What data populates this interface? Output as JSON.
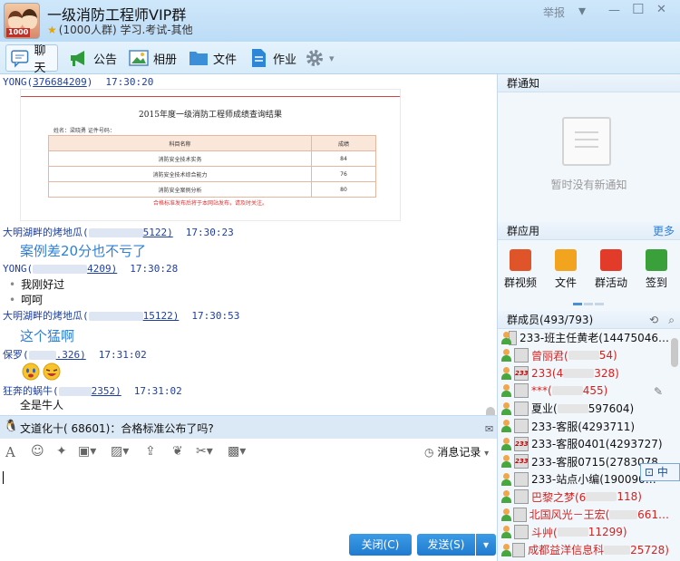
{
  "window": {
    "group_name": "一级消防工程师VIP群",
    "group_meta": "(1000人群) 学习.考试-其他",
    "avatar_badge": "1000",
    "report": "举报",
    "min": "—",
    "max": "☐",
    "close": "✕"
  },
  "toolbar": {
    "chat": "聊天",
    "announce": "公告",
    "album": "相册",
    "files": "文件",
    "homework": "作业"
  },
  "messages": {
    "m1": {
      "sender": "YONG",
      "qq": "376684209",
      "time": "17:30:20"
    },
    "scorecard": {
      "title": "2015年度一级消防工程师成绩查询结果",
      "info": "姓名：梁晓勇     证件号码：",
      "col_subject": "科目名称",
      "col_score": "成绩",
      "rows": [
        {
          "subject": "消防安全技术实务",
          "score": "84"
        },
        {
          "subject": "消防安全技术综合能力",
          "score": "76"
        },
        {
          "subject": "消防安全案例分析",
          "score": "80"
        }
      ],
      "note": "合格标准发布后将于本网站发布，请及时关注。"
    },
    "m2": {
      "sender": "大明湖畔的烤地瓜",
      "qq_suffix": "5122)",
      "time": "17:30:23",
      "text": "案例差20分也不亏了"
    },
    "m3": {
      "sender": "YONG",
      "qq_suffix": "4209)",
      "time": "17:30:28",
      "line1": "我刚好过",
      "line2": "呵呵"
    },
    "m4": {
      "sender": "大明湖畔的烤地瓜",
      "qq_suffix": "15122)",
      "time": "17:30:53",
      "text": "这个猛啊"
    },
    "m5": {
      "sender": "保罗",
      "qq_suffix": ".326)",
      "time": "17:31:02"
    },
    "m6": {
      "sender": "狂奔的蜗牛",
      "qq_suffix": "2352)",
      "time": "17:31:02",
      "text": "全是牛人"
    }
  },
  "notice_bar": {
    "text": "文道化十(       68601)：合格标准公布了吗?"
  },
  "input": {
    "history": "消息记录"
  },
  "buttons": {
    "close": "关闭(C)",
    "send": "发送(S)"
  },
  "right": {
    "notice_title": "群通知",
    "no_notice": "暂时没有新通知",
    "apps_title": "群应用",
    "more": "更多",
    "apps": [
      {
        "label": "群视频",
        "color": "#e0542a"
      },
      {
        "label": "文件",
        "color": "#f2a41e"
      },
      {
        "label": "群活动",
        "color": "#e23b2a"
      },
      {
        "label": "签到",
        "color": "#3aa13a"
      }
    ],
    "members_title": "群成员(493/793)",
    "members": [
      {
        "name": "233-班主任黄老(14475046…",
        "red": false,
        "badge": ""
      },
      {
        "name": "曾丽君(",
        "tail": "54)",
        "red": true,
        "badge": ""
      },
      {
        "name": "233(4",
        "tail": "328)",
        "red": true,
        "badge": "233"
      },
      {
        "name": "***(",
        "tail": "455)",
        "red": true,
        "badge": ""
      },
      {
        "name": "夏业(",
        "tail": "597604)",
        "red": false,
        "badge": ""
      },
      {
        "name": "233-客服(4293711)",
        "red": false,
        "badge": ""
      },
      {
        "name": "233-客服0401(4293727)",
        "red": false,
        "badge": "233"
      },
      {
        "name": "233-客服0715(2783078…",
        "red": false,
        "badge": "233"
      },
      {
        "name": "233-站点小编(190090…",
        "red": false,
        "badge": ""
      },
      {
        "name": "巴黎之梦(6",
        "tail": "118)",
        "red": true,
        "badge": ""
      },
      {
        "name": "北国风光－王宏(",
        "tail": "661…",
        "red": true,
        "badge": ""
      },
      {
        "name": "斗艸(",
        "tail": "11299)",
        "red": true,
        "badge": ""
      },
      {
        "name": "成都益洋信息科",
        "tail": "25728)",
        "red": true,
        "badge": ""
      }
    ]
  },
  "ime": {
    "label": "中"
  }
}
